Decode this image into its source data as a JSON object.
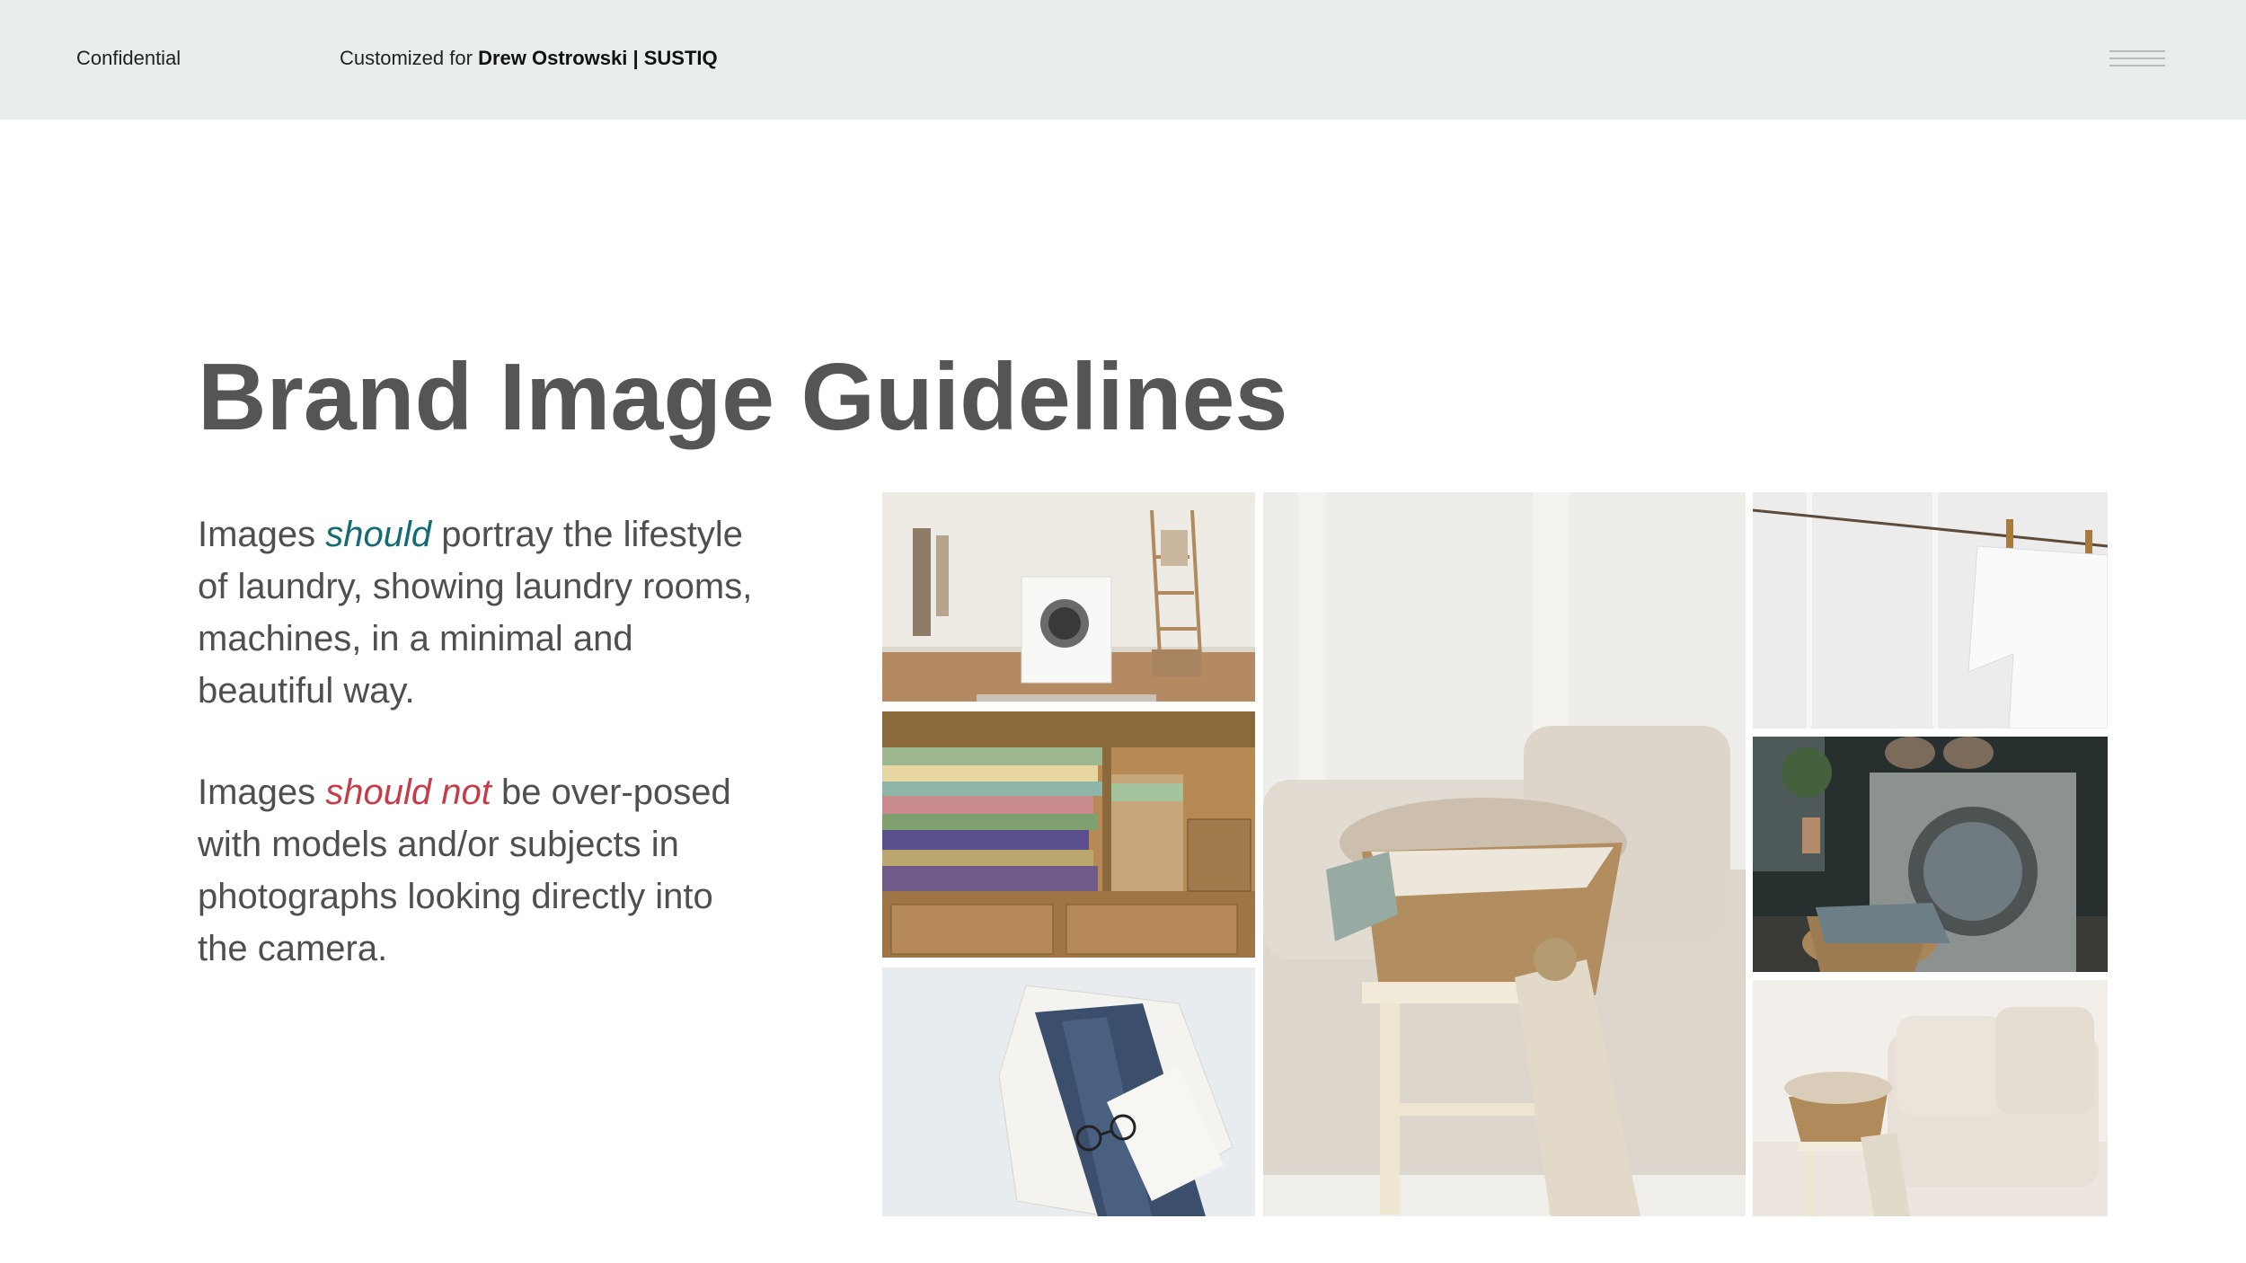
{
  "header": {
    "confidential_label": "Confidential",
    "customized_prefix": "Customized for",
    "customized_for": "Drew Ostrowski | SUSTIQ",
    "menu_icon": "hamburger-menu-icon"
  },
  "main": {
    "title": "Brand Image Guidelines",
    "para1": {
      "before": "Images ",
      "emphasis": "should",
      "after": " portray the lifestyle of laundry, showing laundry rooms, machines, in a minimal and beautiful way."
    },
    "para2": {
      "before": "Images ",
      "emphasis": "should not",
      "after": " be over-posed with models and/or subjects in photographs looking directly into the camera."
    }
  },
  "colors": {
    "header_bg": "#e8eded",
    "title": "#555555",
    "body_text": "#4f4f4f",
    "should_accent": "#136b73",
    "should_not_accent": "#c63d4a"
  }
}
